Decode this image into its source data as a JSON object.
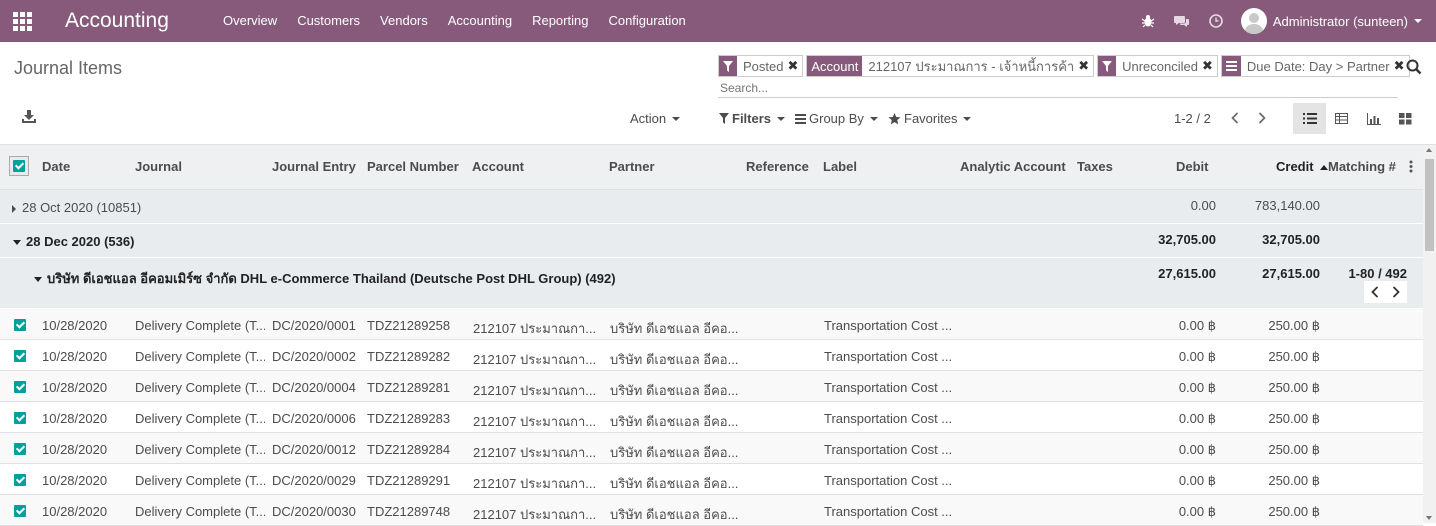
{
  "colors": {
    "brand": "#875a7b",
    "checkbox": "#00a09d"
  },
  "navbar": {
    "app_name": "Accounting",
    "menu": [
      "Overview",
      "Customers",
      "Vendors",
      "Accounting",
      "Reporting",
      "Configuration"
    ],
    "user_name": "Administrator (sunteen)",
    "systray_icons": [
      "bug-icon",
      "chat-icon",
      "clock-icon"
    ]
  },
  "control_panel": {
    "title": "Journal Items",
    "facets": [
      {
        "tag_icon": "filter-icon",
        "tag": "",
        "value": "Posted"
      },
      {
        "tag_icon": "",
        "tag": "Account",
        "value": "212107 ประมาณการ - เจ้าหนี้การค้า"
      },
      {
        "tag_icon": "filter-icon",
        "tag": "",
        "value": "Unreconciled"
      },
      {
        "tag_icon": "groupby-icon",
        "tag": "",
        "value": "Due Date: Day > Partner"
      }
    ],
    "search_placeholder": "Search...",
    "action_label": "Action",
    "filters_label": "Filters",
    "groupby_label": "Group By",
    "favorites_label": "Favorites",
    "pager": "1-2 / 2"
  },
  "table": {
    "columns": [
      "Date",
      "Journal",
      "Journal Entry",
      "Parcel Number",
      "Account",
      "Partner",
      "Reference",
      "Label",
      "Analytic Account",
      "Taxes",
      "Debit",
      "Credit",
      "Matching #"
    ],
    "sorted_column": "Credit",
    "groups": [
      {
        "label": "28 Oct 2020 (10851)",
        "debit": "0.00",
        "credit": "783,140.00",
        "expanded": false
      },
      {
        "label": "28 Dec 2020 (536)",
        "debit": "32,705.00",
        "credit": "32,705.00",
        "expanded": true
      }
    ],
    "subgroup": {
      "label": "บริษัท ดีเอชแอล อีคอมเมิร์ซ จำกัด DHL e-Commerce Thailand (Deutsche Post DHL Group) (492)",
      "debit": "27,615.00",
      "credit": "27,615.00",
      "pager": "1-80 / 492"
    },
    "rows": [
      {
        "date": "10/28/2020",
        "journal": "Delivery Complete (T...",
        "entry": "DC/2020/0001",
        "parcel": "TDZ21289258",
        "account": "212107 ประมาณกา...",
        "partner": "บริษัท ดีเอชแอล อีคอ...",
        "label": "Transportation Cost ...",
        "debit": "0.00 ฿",
        "credit": "250.00 ฿"
      },
      {
        "date": "10/28/2020",
        "journal": "Delivery Complete (T...",
        "entry": "DC/2020/0002",
        "parcel": "TDZ21289282",
        "account": "212107 ประมาณกา...",
        "partner": "บริษัท ดีเอชแอล อีคอ...",
        "label": "Transportation Cost ...",
        "debit": "0.00 ฿",
        "credit": "250.00 ฿"
      },
      {
        "date": "10/28/2020",
        "journal": "Delivery Complete (T...",
        "entry": "DC/2020/0004",
        "parcel": "TDZ21289281",
        "account": "212107 ประมาณกา...",
        "partner": "บริษัท ดีเอชแอล อีคอ...",
        "label": "Transportation Cost ...",
        "debit": "0.00 ฿",
        "credit": "250.00 ฿"
      },
      {
        "date": "10/28/2020",
        "journal": "Delivery Complete (T...",
        "entry": "DC/2020/0006",
        "parcel": "TDZ21289283",
        "account": "212107 ประมาณกา...",
        "partner": "บริษัท ดีเอชแอล อีคอ...",
        "label": "Transportation Cost ...",
        "debit": "0.00 ฿",
        "credit": "250.00 ฿"
      },
      {
        "date": "10/28/2020",
        "journal": "Delivery Complete (T...",
        "entry": "DC/2020/0012",
        "parcel": "TDZ21289284",
        "account": "212107 ประมาณกา...",
        "partner": "บริษัท ดีเอชแอล อีคอ...",
        "label": "Transportation Cost ...",
        "debit": "0.00 ฿",
        "credit": "250.00 ฿"
      },
      {
        "date": "10/28/2020",
        "journal": "Delivery Complete (T...",
        "entry": "DC/2020/0029",
        "parcel": "TDZ21289291",
        "account": "212107 ประมาณกา...",
        "partner": "บริษัท ดีเอชแอล อีคอ...",
        "label": "Transportation Cost ...",
        "debit": "0.00 ฿",
        "credit": "250.00 ฿"
      },
      {
        "date": "10/28/2020",
        "journal": "Delivery Complete (T...",
        "entry": "DC/2020/0030",
        "parcel": "TDZ21289748",
        "account": "212107 ประมาณกา...",
        "partner": "บริษัท ดีเอชแอล อีคอ...",
        "label": "Transportation Cost ...",
        "debit": "0.00 ฿",
        "credit": "250.00 ฿"
      }
    ]
  }
}
